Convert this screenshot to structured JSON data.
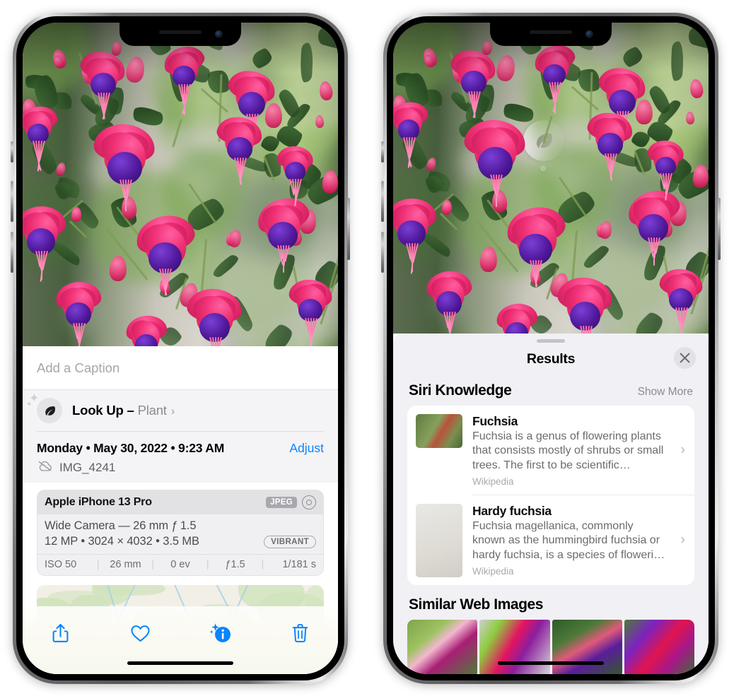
{
  "left_phone": {
    "caption": {
      "placeholder": "Add a Caption",
      "value": ""
    },
    "lookup": {
      "label": "Look Up –",
      "subject": "Plant",
      "chevron": "›",
      "icon": "leaf-icon"
    },
    "meta": {
      "date": "Monday • May 30, 2022 • 9:23 AM",
      "adjust_label": "Adjust",
      "filename": "IMG_4241",
      "cloud_icon": "cloud-slash-icon"
    },
    "camera_card": {
      "model": "Apple iPhone 13 Pro",
      "format_badge": "JPEG",
      "raw_icon": "aperture-icon",
      "lens": "Wide Camera — 26 mm ƒ 1.5",
      "size": "12 MP • 3024 × 4032 • 3.5 MB",
      "profile_badge": "VIBRANT",
      "exif": [
        "ISO 50",
        "26 mm",
        "0 ev",
        "ƒ1.5",
        "1/181 s"
      ]
    },
    "toolbar": [
      {
        "name": "share-button",
        "icon": "share-icon"
      },
      {
        "name": "favorite-button",
        "icon": "heart-icon"
      },
      {
        "name": "info-button",
        "icon": "info-sparkle-icon"
      },
      {
        "name": "delete-button",
        "icon": "trash-icon"
      }
    ],
    "accent_color": "#0a84ff"
  },
  "right_phone": {
    "lens_badge": {
      "icon": "leaf-icon"
    },
    "sheet": {
      "title": "Results",
      "close_icon": "close-icon",
      "sections": [
        {
          "title": "Siri Knowledge",
          "action": "Show More",
          "items": [
            {
              "title": "Fuchsia",
              "description": "Fuchsia is a genus of flowering plants that consists mostly of shrubs or small trees. The first to be scientific…",
              "source": "Wikipedia",
              "chevron": "›"
            },
            {
              "title": "Hardy fuchsia",
              "description": "Fuchsia magellanica, commonly known as the hummingbird fuchsia or hardy fuchsia, is a species of floweri…",
              "source": "Wikipedia",
              "chevron": "›"
            }
          ]
        },
        {
          "title": "Similar Web Images",
          "action": "",
          "thumbnails": [
            "web-image-1",
            "web-image-2",
            "web-image-3",
            "web-image-4"
          ]
        }
      ]
    }
  }
}
